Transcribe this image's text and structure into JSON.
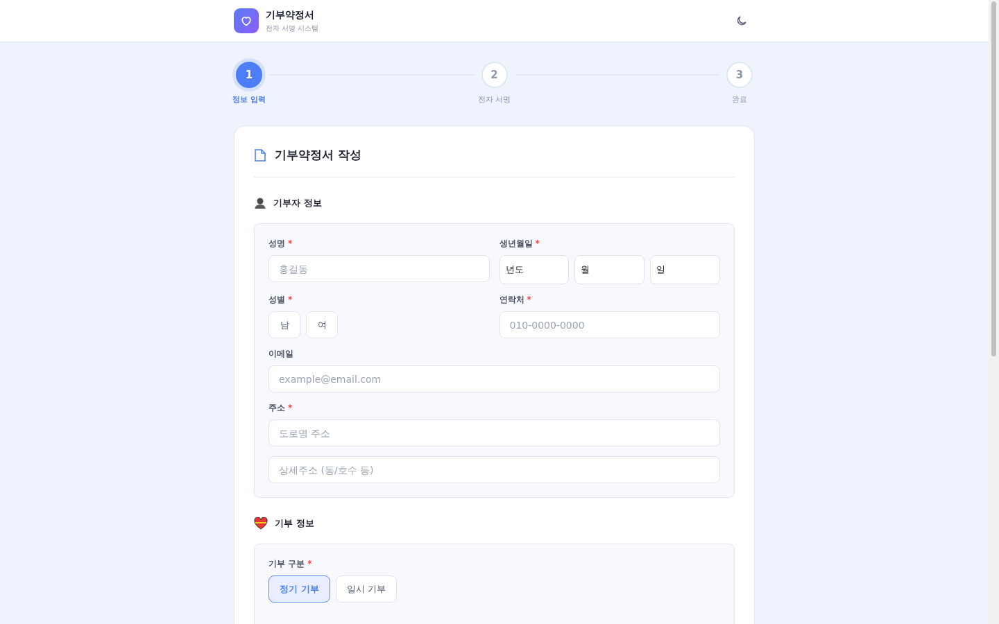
{
  "header": {
    "title": "기부약정서",
    "subtitle": "전자 서명 시스템"
  },
  "steps": [
    {
      "number": "1",
      "label": "정보 입력",
      "selected": true
    },
    {
      "number": "2",
      "label": "전자 서명",
      "selected": false
    },
    {
      "number": "3",
      "label": "완료",
      "selected": false
    }
  ],
  "form": {
    "title": "기부약정서 작성",
    "donor_section": {
      "title": "기부자 정보",
      "name": {
        "label": "성명",
        "mark": "*",
        "placeholder": "홍길동"
      },
      "birth": {
        "label": "생년월일",
        "mark": "*",
        "selects": [
          "년도",
          "월",
          "일"
        ]
      },
      "gender": {
        "label": "성별",
        "mark": "*",
        "options": [
          {
            "label": "남",
            "selected": false
          },
          {
            "label": "여",
            "selected": false
          }
        ]
      },
      "phone": {
        "label": "연락처",
        "mark": "*",
        "placeholder": "010-0000-0000"
      },
      "email": {
        "label": "이메일",
        "placeholder": "example@email.com"
      },
      "address": {
        "label": "주소",
        "mark": "*",
        "placeholder": "도로명 주소",
        "detail_placeholder": "상세주소 (동/호수 등)"
      }
    },
    "donation_section": {
      "title": "기부 정보",
      "type": {
        "label": "기부 구분",
        "mark": "*",
        "options": [
          {
            "label": "정기 기부",
            "selected": true
          },
          {
            "label": "일시 기부",
            "selected": false
          }
        ]
      }
    }
  }
}
